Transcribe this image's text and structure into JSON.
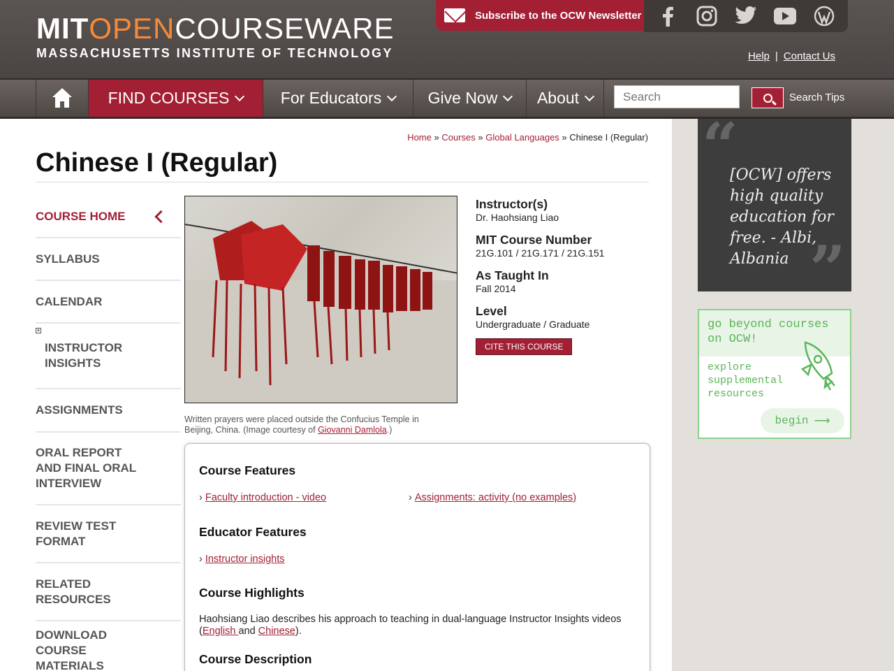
{
  "header": {
    "logo_mit": "MIT",
    "logo_open": "OPEN",
    "logo_courseware": "COURSEWARE",
    "logo_subtitle": "MASSACHUSETTS INSTITUTE OF TECHNOLOGY",
    "subscribe_label": "Subscribe to the OCW Newsletter",
    "social": [
      "facebook-icon",
      "instagram-icon",
      "twitter-icon",
      "youtube-icon",
      "wordpress-icon"
    ],
    "help_label": "Help",
    "separator": "|",
    "contact_label": "Contact Us"
  },
  "nav": {
    "find_courses": "FIND COURSES",
    "for_educators": "For Educators",
    "give_now": "Give Now",
    "about": "About",
    "search_placeholder": "Search",
    "search_tips": "Search Tips"
  },
  "breadcrumb": {
    "home": "Home",
    "courses": "Courses",
    "global_languages": "Global Languages",
    "sep": "»",
    "current": "Chinese I (Regular)"
  },
  "page_title": "Chinese I (Regular)",
  "sidebar": {
    "items": [
      {
        "label": "COURSE HOME"
      },
      {
        "label": "SYLLABUS"
      },
      {
        "label": "CALENDAR"
      },
      {
        "label": "INSTRUCTOR INSIGHTS"
      },
      {
        "label": "ASSIGNMENTS"
      },
      {
        "label": "ORAL REPORT AND FINAL ORAL INTERVIEW"
      },
      {
        "label": "REVIEW TEST FORMAT"
      },
      {
        "label": "RELATED RESOURCES"
      },
      {
        "label": "DOWNLOAD COURSE MATERIALS"
      }
    ]
  },
  "image": {
    "caption_prefix": "Written prayers were placed outside the Confucius Temple in Beijing, China. (Image courtesy of",
    "caption_link": "Giovanni Damlola",
    "caption_suffix": ".)"
  },
  "info": {
    "instructors_label": "Instructor(s)",
    "instructors_value": "Dr. Haohsiang Liao",
    "course_number_label": "MIT Course Number",
    "course_number_value": "21G.101 / 21G.171 / 21G.151",
    "taught_label": "As Taught In",
    "taught_value": "Fall 2014",
    "level_label": "Level",
    "level_value": "Undergraduate / Graduate",
    "cite_label": "CITE THIS COURSE"
  },
  "features": {
    "course_features_heading": "Course Features",
    "course_features": [
      "Faculty introduction - video",
      "Assignments: activity (no examples)"
    ],
    "educator_features_heading": "Educator Features",
    "educator_features": [
      "Instructor insights"
    ],
    "highlights_heading": "Course Highlights",
    "highlights_text": "Haohsiang Liao describes his approach to teaching in dual-language Instructor Insights videos (",
    "highlights_link_english": "English ",
    "highlights_and": "and",
    "highlights_link_chinese": "Chinese",
    "highlights_end": ").",
    "description_heading": "Course Description"
  },
  "promo": {
    "quote_text": "[OCW] offers high quality education for free. - Albi, Albania",
    "beyond_title": "go beyond courses on OCW!",
    "beyond_sub": "explore supplemental resources",
    "begin_label": "begin",
    "begin_arrow": "⟶"
  },
  "colors": {
    "accent": "#a31f34",
    "header_bg": "#4a4542",
    "promo_green": "#5bb55a"
  }
}
